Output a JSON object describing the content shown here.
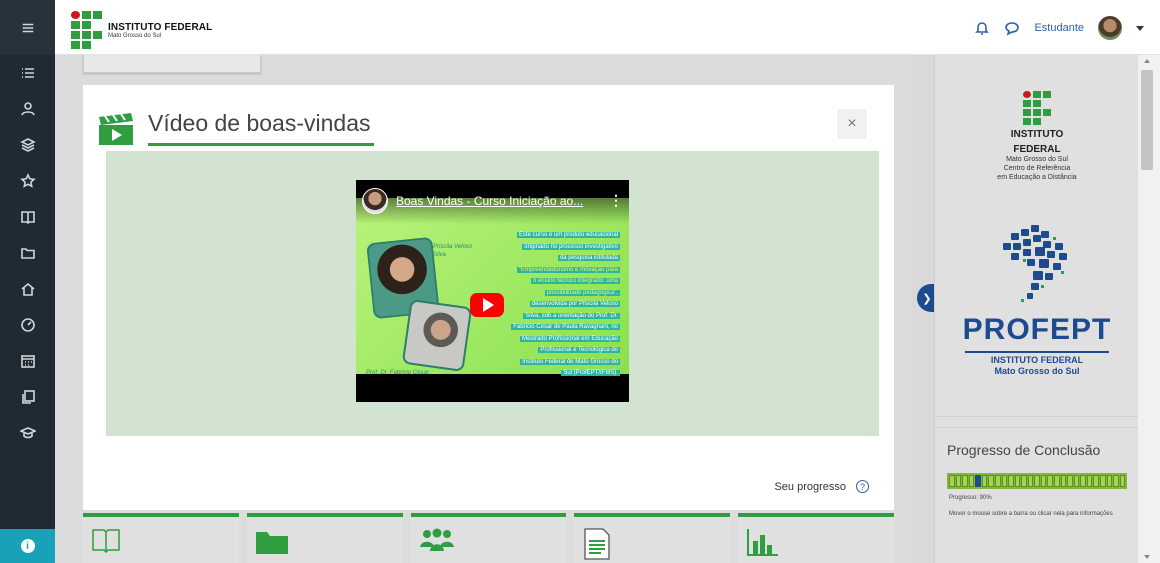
{
  "navbar": {
    "logo_line1": "INSTITUTO FEDERAL",
    "logo_line2": "Mato Grosso do Sul",
    "user_name": "Estudante"
  },
  "modal": {
    "title": "Vídeo de boas-vindas",
    "close_label": "×",
    "progress_label": "Seu progresso",
    "help_label": "?"
  },
  "video": {
    "title": "Boas Vindas - Curso Iniciação ao...",
    "menu_label": "⋮",
    "presenter1": "Priscila Veloso Silva",
    "presenter2": "Prof. Dr. Fabricio César",
    "description_lines": [
      "Este curso é um produto educacional",
      "originado no processo investigativo",
      "da pesquisa intitulada",
      "\"Empreendedorismo e Inovação para",
      "o ensino técnico integrado: uma",
      "possibilidade pedagógica\",",
      "desenvolvida por Priscila Veloso",
      "Silva, sob a orientação do Prof. Dr.",
      "Fabricio César de Paula Ravagnani, no",
      "Mestrado Profissional em Educação",
      "Profissional e Tecnológica do",
      "Instituto Federal de Mato Grosso do",
      "Sul (ProfEPT/IFMS)."
    ]
  },
  "drawer": {
    "if_title1": "INSTITUTO",
    "if_title2": "FEDERAL",
    "if_sub1": "Mato Grosso do Sul",
    "if_sub2": "Centro de Referência",
    "if_sub3": "em Educação a Distância",
    "profept": "PROFEPT",
    "profept_sub1": "INSTITUTO FEDERAL",
    "profept_sub2": "Mato Grosso do Sul",
    "progress_title": "Progresso de Conclusão",
    "progress_text": "Progresso: 90%",
    "progress_value": 0.9,
    "progress_hint": "Mover o mouse sobre a barra ou clicar nela para informações"
  },
  "colors": {
    "brand_green": "#2f9e41",
    "brand_blue": "#1e4b8f",
    "rail": "#1f2a33"
  }
}
